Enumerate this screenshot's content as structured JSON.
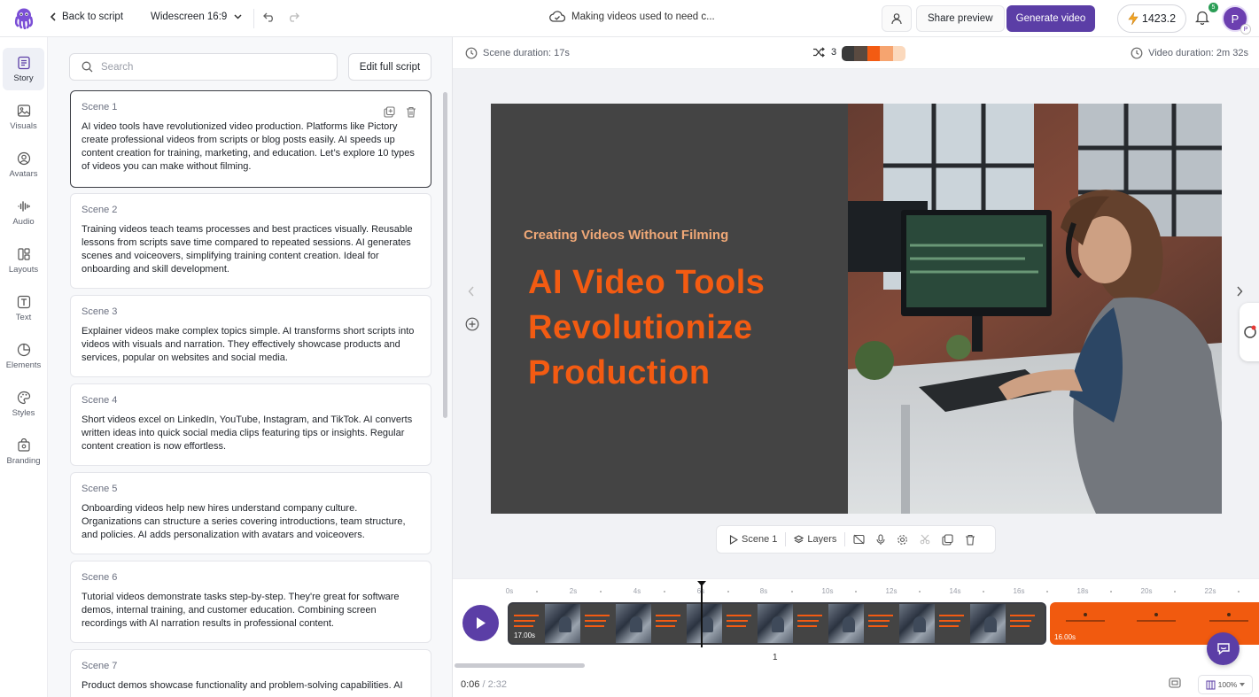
{
  "topbar": {
    "back_label": "Back to script",
    "aspect_ratio": "Widescreen 16:9",
    "project_title": "Making videos used to need c...",
    "share_label": "Share preview",
    "generate_label": "Generate video",
    "credits": "1423.2",
    "notifications_count": "5",
    "avatar_initial": "P",
    "avatar_sub": "P",
    "accent_color": "#5b3ea6"
  },
  "rail": {
    "items": [
      {
        "label": "Story",
        "icon": "story-icon"
      },
      {
        "label": "Visuals",
        "icon": "image-icon"
      },
      {
        "label": "Avatars",
        "icon": "avatar-icon"
      },
      {
        "label": "Audio",
        "icon": "audio-wave-icon"
      },
      {
        "label": "Layouts",
        "icon": "layout-icon"
      },
      {
        "label": "Text",
        "icon": "text-icon"
      },
      {
        "label": "Elements",
        "icon": "elements-icon"
      },
      {
        "label": "Styles",
        "icon": "palette-icon"
      },
      {
        "label": "Branding",
        "icon": "branding-icon"
      }
    ]
  },
  "script": {
    "search_placeholder": "Search",
    "edit_full_label": "Edit full script",
    "scenes": [
      {
        "label": "Scene 1",
        "text": "AI video tools have revolutionized video production. Platforms like Pictory create professional videos from scripts or blog posts easily. AI speeds up content creation for training, marketing, and education. Let’s explore 10 types of videos you can make without filming."
      },
      {
        "label": "Scene 2",
        "text": "Training videos teach teams processes and best practices visually. Reusable lessons from scripts save time compared to repeated sessions. AI generates scenes and voiceovers, simplifying training content creation. Ideal for onboarding and skill development."
      },
      {
        "label": "Scene 3",
        "text": "Explainer videos make complex topics simple. AI transforms short scripts into videos with visuals and narration. They effectively showcase products and services, popular on websites and social media."
      },
      {
        "label": "Scene 4",
        "text": "Short videos excel on LinkedIn, YouTube, Instagram, and TikTok. AI converts written ideas into quick social media clips featuring tips or insights. Regular content creation is now effortless."
      },
      {
        "label": "Scene 5",
        "text": "Onboarding videos help new hires understand company culture. Organizations can structure a series covering introductions, team structure, and policies. AI adds personalization with avatars and voiceovers."
      },
      {
        "label": "Scene 6",
        "text": "Tutorial videos demonstrate tasks step-by-step. They're great for software demos, internal training, and customer education. Combining screen recordings with AI narration results in professional content."
      },
      {
        "label": "Scene 7",
        "text": "Product demos showcase functionality and problem-solving capabilities. AI"
      }
    ]
  },
  "editor": {
    "scene_duration": "Scene duration: 17s",
    "video_duration": "Video duration: 2m 32s",
    "shuffle_count": "3",
    "palette": [
      "#3a3a3a",
      "#5a4a40",
      "#f35b12",
      "#f6a46f",
      "#fbd9bd"
    ],
    "slide": {
      "subtitle": "Creating Videos Without Filming",
      "headline": [
        "AI Video Tools",
        "Revolutionize",
        "Production"
      ],
      "bg_color": "#444444",
      "headline_color": "#f35b12",
      "subtitle_color": "#f0a877"
    },
    "toolbar": {
      "scene_label": "Scene 1",
      "layers_label": "Layers"
    }
  },
  "timeline": {
    "ticks": [
      "0s",
      "2s",
      "4s",
      "6s",
      "8s",
      "10s",
      "12s",
      "14s",
      "16s",
      "18s",
      "20s",
      "22s"
    ],
    "clip1_duration": "17.00s",
    "clip2_duration": "16.00s",
    "clip_number": "1",
    "current_time": "0:06",
    "total_time": "2:32",
    "zoom": "100%"
  }
}
